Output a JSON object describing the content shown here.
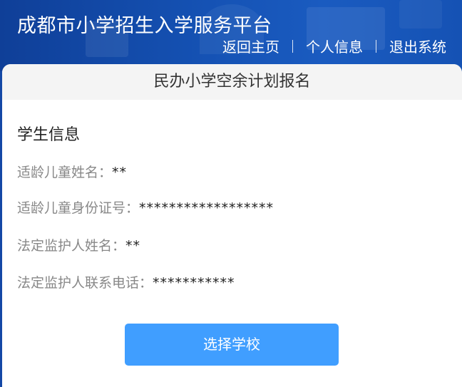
{
  "header": {
    "title": "成都市小学招生入学服务平台",
    "nav": {
      "home": "返回主页",
      "profile": "个人信息",
      "logout": "退出系统"
    }
  },
  "card": {
    "title": "民办小学空余计划报名",
    "section_title": "学生信息",
    "fields": [
      {
        "label": "适龄儿童姓名：",
        "value": "**"
      },
      {
        "label": "适龄儿童身份证号：",
        "value": "******************"
      },
      {
        "label": "法定监护人姓名：",
        "value": "**"
      },
      {
        "label": "法定监护人联系电话：",
        "value": "***********"
      }
    ],
    "button_label": "选择学校"
  },
  "colors": {
    "header_bg": "#1552b4",
    "button_bg": "#409eff",
    "card_header_bg": "#f4f4f4"
  }
}
